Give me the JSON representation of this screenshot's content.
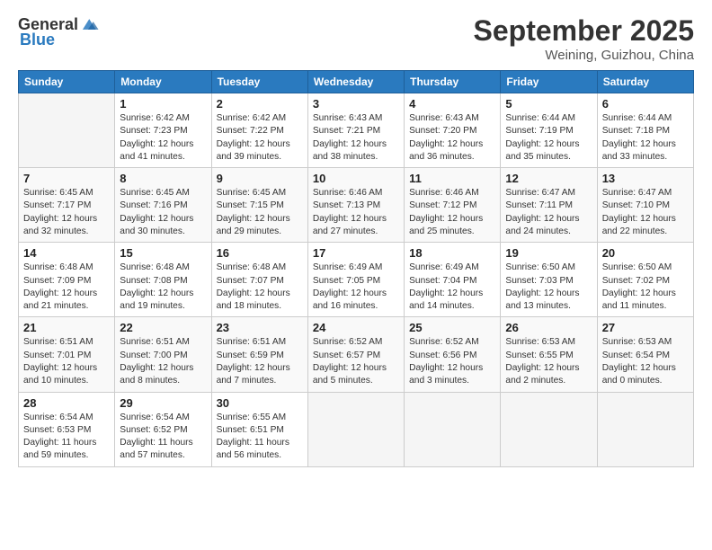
{
  "header": {
    "logo_general": "General",
    "logo_blue": "Blue",
    "month": "September 2025",
    "location": "Weining, Guizhou, China"
  },
  "weekdays": [
    "Sunday",
    "Monday",
    "Tuesday",
    "Wednesday",
    "Thursday",
    "Friday",
    "Saturday"
  ],
  "weeks": [
    [
      {
        "day": "",
        "sunrise": "",
        "sunset": "",
        "daylight": ""
      },
      {
        "day": "1",
        "sunrise": "Sunrise: 6:42 AM",
        "sunset": "Sunset: 7:23 PM",
        "daylight": "Daylight: 12 hours and 41 minutes."
      },
      {
        "day": "2",
        "sunrise": "Sunrise: 6:42 AM",
        "sunset": "Sunset: 7:22 PM",
        "daylight": "Daylight: 12 hours and 39 minutes."
      },
      {
        "day": "3",
        "sunrise": "Sunrise: 6:43 AM",
        "sunset": "Sunset: 7:21 PM",
        "daylight": "Daylight: 12 hours and 38 minutes."
      },
      {
        "day": "4",
        "sunrise": "Sunrise: 6:43 AM",
        "sunset": "Sunset: 7:20 PM",
        "daylight": "Daylight: 12 hours and 36 minutes."
      },
      {
        "day": "5",
        "sunrise": "Sunrise: 6:44 AM",
        "sunset": "Sunset: 7:19 PM",
        "daylight": "Daylight: 12 hours and 35 minutes."
      },
      {
        "day": "6",
        "sunrise": "Sunrise: 6:44 AM",
        "sunset": "Sunset: 7:18 PM",
        "daylight": "Daylight: 12 hours and 33 minutes."
      }
    ],
    [
      {
        "day": "7",
        "sunrise": "Sunrise: 6:45 AM",
        "sunset": "Sunset: 7:17 PM",
        "daylight": "Daylight: 12 hours and 32 minutes."
      },
      {
        "day": "8",
        "sunrise": "Sunrise: 6:45 AM",
        "sunset": "Sunset: 7:16 PM",
        "daylight": "Daylight: 12 hours and 30 minutes."
      },
      {
        "day": "9",
        "sunrise": "Sunrise: 6:45 AM",
        "sunset": "Sunset: 7:15 PM",
        "daylight": "Daylight: 12 hours and 29 minutes."
      },
      {
        "day": "10",
        "sunrise": "Sunrise: 6:46 AM",
        "sunset": "Sunset: 7:13 PM",
        "daylight": "Daylight: 12 hours and 27 minutes."
      },
      {
        "day": "11",
        "sunrise": "Sunrise: 6:46 AM",
        "sunset": "Sunset: 7:12 PM",
        "daylight": "Daylight: 12 hours and 25 minutes."
      },
      {
        "day": "12",
        "sunrise": "Sunrise: 6:47 AM",
        "sunset": "Sunset: 7:11 PM",
        "daylight": "Daylight: 12 hours and 24 minutes."
      },
      {
        "day": "13",
        "sunrise": "Sunrise: 6:47 AM",
        "sunset": "Sunset: 7:10 PM",
        "daylight": "Daylight: 12 hours and 22 minutes."
      }
    ],
    [
      {
        "day": "14",
        "sunrise": "Sunrise: 6:48 AM",
        "sunset": "Sunset: 7:09 PM",
        "daylight": "Daylight: 12 hours and 21 minutes."
      },
      {
        "day": "15",
        "sunrise": "Sunrise: 6:48 AM",
        "sunset": "Sunset: 7:08 PM",
        "daylight": "Daylight: 12 hours and 19 minutes."
      },
      {
        "day": "16",
        "sunrise": "Sunrise: 6:48 AM",
        "sunset": "Sunset: 7:07 PM",
        "daylight": "Daylight: 12 hours and 18 minutes."
      },
      {
        "day": "17",
        "sunrise": "Sunrise: 6:49 AM",
        "sunset": "Sunset: 7:05 PM",
        "daylight": "Daylight: 12 hours and 16 minutes."
      },
      {
        "day": "18",
        "sunrise": "Sunrise: 6:49 AM",
        "sunset": "Sunset: 7:04 PM",
        "daylight": "Daylight: 12 hours and 14 minutes."
      },
      {
        "day": "19",
        "sunrise": "Sunrise: 6:50 AM",
        "sunset": "Sunset: 7:03 PM",
        "daylight": "Daylight: 12 hours and 13 minutes."
      },
      {
        "day": "20",
        "sunrise": "Sunrise: 6:50 AM",
        "sunset": "Sunset: 7:02 PM",
        "daylight": "Daylight: 12 hours and 11 minutes."
      }
    ],
    [
      {
        "day": "21",
        "sunrise": "Sunrise: 6:51 AM",
        "sunset": "Sunset: 7:01 PM",
        "daylight": "Daylight: 12 hours and 10 minutes."
      },
      {
        "day": "22",
        "sunrise": "Sunrise: 6:51 AM",
        "sunset": "Sunset: 7:00 PM",
        "daylight": "Daylight: 12 hours and 8 minutes."
      },
      {
        "day": "23",
        "sunrise": "Sunrise: 6:51 AM",
        "sunset": "Sunset: 6:59 PM",
        "daylight": "Daylight: 12 hours and 7 minutes."
      },
      {
        "day": "24",
        "sunrise": "Sunrise: 6:52 AM",
        "sunset": "Sunset: 6:57 PM",
        "daylight": "Daylight: 12 hours and 5 minutes."
      },
      {
        "day": "25",
        "sunrise": "Sunrise: 6:52 AM",
        "sunset": "Sunset: 6:56 PM",
        "daylight": "Daylight: 12 hours and 3 minutes."
      },
      {
        "day": "26",
        "sunrise": "Sunrise: 6:53 AM",
        "sunset": "Sunset: 6:55 PM",
        "daylight": "Daylight: 12 hours and 2 minutes."
      },
      {
        "day": "27",
        "sunrise": "Sunrise: 6:53 AM",
        "sunset": "Sunset: 6:54 PM",
        "daylight": "Daylight: 12 hours and 0 minutes."
      }
    ],
    [
      {
        "day": "28",
        "sunrise": "Sunrise: 6:54 AM",
        "sunset": "Sunset: 6:53 PM",
        "daylight": "Daylight: 11 hours and 59 minutes."
      },
      {
        "day": "29",
        "sunrise": "Sunrise: 6:54 AM",
        "sunset": "Sunset: 6:52 PM",
        "daylight": "Daylight: 11 hours and 57 minutes."
      },
      {
        "day": "30",
        "sunrise": "Sunrise: 6:55 AM",
        "sunset": "Sunset: 6:51 PM",
        "daylight": "Daylight: 11 hours and 56 minutes."
      },
      {
        "day": "",
        "sunrise": "",
        "sunset": "",
        "daylight": ""
      },
      {
        "day": "",
        "sunrise": "",
        "sunset": "",
        "daylight": ""
      },
      {
        "day": "",
        "sunrise": "",
        "sunset": "",
        "daylight": ""
      },
      {
        "day": "",
        "sunrise": "",
        "sunset": "",
        "daylight": ""
      }
    ]
  ]
}
